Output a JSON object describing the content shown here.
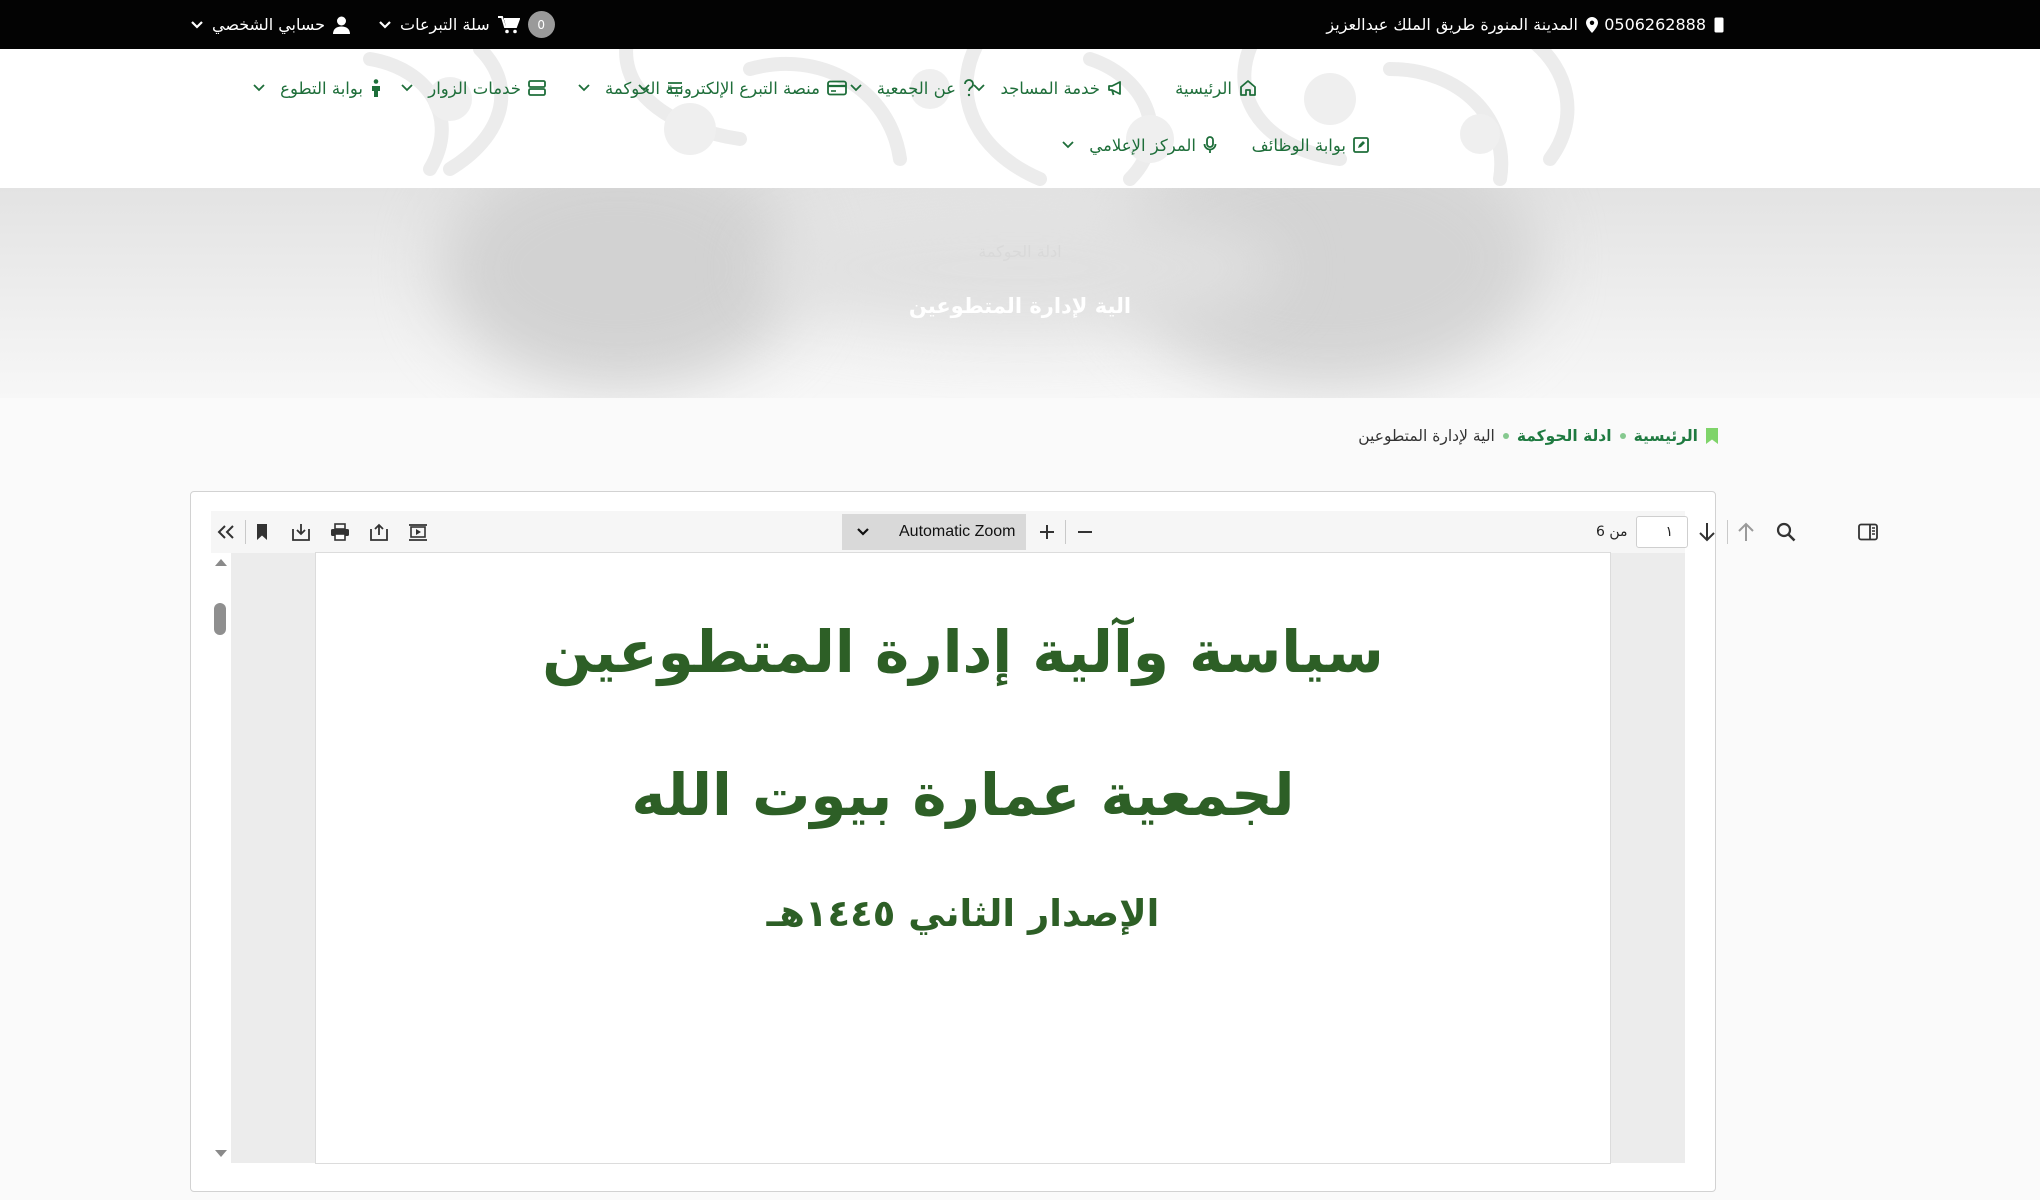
{
  "topbar": {
    "phone": "0506262888",
    "address": "المدينة المنورة طريق الملك عبدالعزيز",
    "cart_label": "سلة التبرعات",
    "cart_count": "0",
    "account_label": "حسابي الشخصي"
  },
  "nav": {
    "items": [
      {
        "label": "الرئيسية",
        "icon": "home-icon"
      },
      {
        "label": "خدمة المساجد",
        "icon": "megaphone-icon"
      },
      {
        "label": "عن الجمعية",
        "icon": "question-icon"
      },
      {
        "label": "منصة التبرع الإلكترونية",
        "icon": "credit-card-icon"
      },
      {
        "label": "الحوكمة",
        "icon": "list-icon"
      },
      {
        "label": "خدمات الزوار",
        "icon": "server-icon"
      },
      {
        "label": "بوابة التطوع",
        "icon": "person-icon"
      },
      {
        "label": "بوابة الوظائف",
        "icon": "edit-icon"
      },
      {
        "label": "المركز الإعلامي",
        "icon": "microphone-icon"
      }
    ]
  },
  "hero": {
    "subtitle": "ادلة الحوكمة",
    "title": "الية لإدارة المتطوعين"
  },
  "breadcrumb": {
    "home": "الرئيسية",
    "section": "ادلة الحوكمة",
    "current": "الية لإدارة المتطوعين"
  },
  "pdf_viewer": {
    "zoom_label": "Automatic Zoom",
    "page_value": "١",
    "page_count_label": "من 6",
    "document": {
      "title_line1": "سياسة وآلية إدارة المتطوعين",
      "title_line2": "لجمعية عمارة بيوت الله",
      "edition": "الإصدار الثاني ١٤٤٥هـ"
    }
  },
  "colors": {
    "topbar_bg": "#030303",
    "nav_green": "#1e6e3a",
    "breadcrumb_green": "#1e7a40",
    "doc_title_green": "#2d5f26"
  }
}
